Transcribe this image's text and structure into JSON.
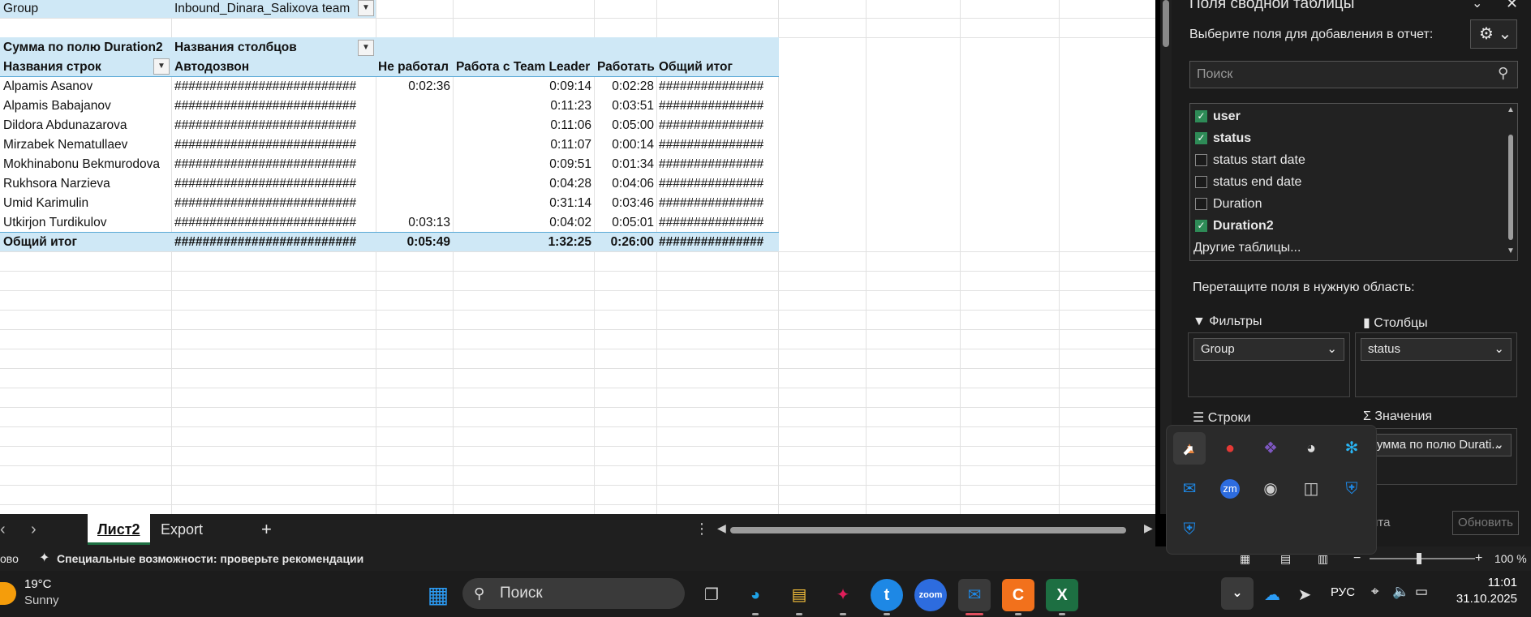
{
  "sheet": {
    "filter_label": "Group",
    "filter_value": "Inbound_Dinara_Salixova team",
    "values_caption": "Сумма по полю Duration2",
    "columns_caption": "Названия столбцов",
    "row_labels_caption": "Названия строк",
    "col_headers": [
      "Автодозвон",
      "Не работал",
      "Работа с Team Leader",
      "Работать",
      "Общий итог"
    ],
    "rows": [
      {
        "name": "Alpamis Asanov",
        "c1": "##########################",
        "c2": "0:02:36",
        "c3": "0:09:14",
        "c4": "0:02:28",
        "c5": "###############"
      },
      {
        "name": "Alpamis Babajanov",
        "c1": "##########################",
        "c2": "",
        "c3": "0:11:23",
        "c4": "0:03:51",
        "c5": "###############"
      },
      {
        "name": "Dildora Abdunazarova",
        "c1": "##########################",
        "c2": "",
        "c3": "0:11:06",
        "c4": "0:05:00",
        "c5": "###############"
      },
      {
        "name": "Mirzabek Nematullaev",
        "c1": "##########################",
        "c2": "",
        "c3": "0:11:07",
        "c4": "0:00:14",
        "c5": "###############"
      },
      {
        "name": "Mokhinabonu Bekmurodova",
        "c1": "##########################",
        "c2": "",
        "c3": "0:09:51",
        "c4": "0:01:34",
        "c5": "###############"
      },
      {
        "name": "Rukhsora Narzieva",
        "c1": "##########################",
        "c2": "",
        "c3": "0:04:28",
        "c4": "0:04:06",
        "c5": "###############"
      },
      {
        "name": "Umid Karimulin",
        "c1": "##########################",
        "c2": "",
        "c3": "0:31:14",
        "c4": "0:03:46",
        "c5": "###############"
      },
      {
        "name": "Utkirjon Turdikulov",
        "c1": "##########################",
        "c2": "0:03:13",
        "c3": "0:04:02",
        "c4": "0:05:01",
        "c5": "###############"
      }
    ],
    "total": {
      "name": "Общий итог",
      "c1": "##########################",
      "c2": "0:05:49",
      "c3": "1:32:25",
      "c4": "0:26:00",
      "c5": "###############"
    }
  },
  "tabs": {
    "sheet1": "Лист2",
    "sheet2": "Export",
    "add": "+"
  },
  "status": {
    "left_fragment": "ово",
    "accessibility": "Специальные возможности: проверьте рекомендации",
    "zoom": "100 %"
  },
  "pivot_panel": {
    "title": "Поля сводной таблицы",
    "subtitle": "Выберите поля для добавления в отчет:",
    "search_placeholder": "Поиск",
    "fields": [
      {
        "label": "user",
        "checked": true
      },
      {
        "label": "status",
        "checked": true
      },
      {
        "label": "status start date",
        "checked": false
      },
      {
        "label": "status end date",
        "checked": false
      },
      {
        "label": "Duration",
        "checked": false
      },
      {
        "label": "Duration2",
        "checked": true
      }
    ],
    "other_tables": "Другие таблицы...",
    "drag_hint": "Перетащите поля в нужную область:",
    "areas": {
      "filters": "Фильтры",
      "columns": "Столбцы",
      "rows": "Строки",
      "values": "Значения"
    },
    "filter_item": "Group",
    "column_item": "status",
    "value_item": "Сумма по полю Durati...",
    "defer_fragment": "ита",
    "update_button": "Обновить"
  },
  "taskbar": {
    "weather_temp": "19°C",
    "weather_desc": "Sunny",
    "search_placeholder": "Поиск",
    "language": "РУС",
    "time": "11:01",
    "date": "31.10.2025"
  }
}
